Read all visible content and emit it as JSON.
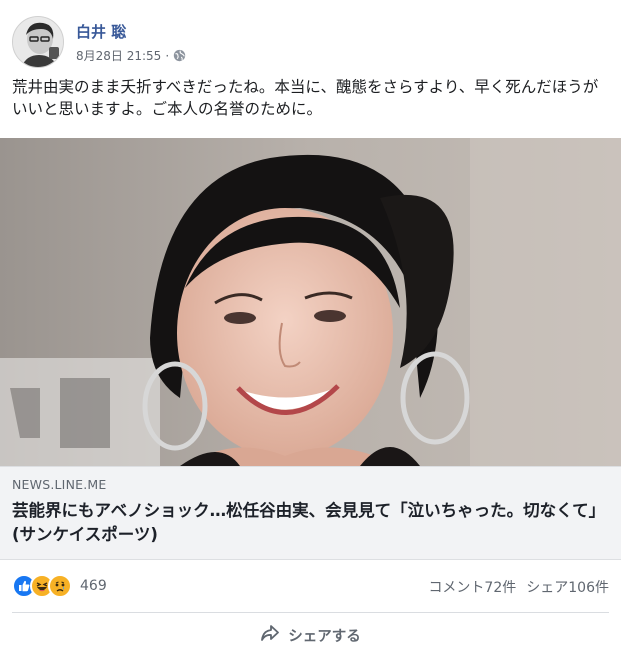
{
  "post": {
    "author": "白井 聡",
    "date": "8月28日 21:55",
    "meta_separator": "·",
    "text": "荒井由実のまま夭折すべきだったね。本当に、醜態をさらすより、早く死んだほうがいいと思いますよ。ご本人の名誉のために。"
  },
  "link_preview": {
    "domain": "NEWS.LINE.ME",
    "title": "芸能界にもアベノショック…松任谷由実、会見見て「泣いちゃった。切なくて」 (サンケイスポーツ)"
  },
  "stats": {
    "reaction_count": "469",
    "reaction_icons": [
      "like-icon",
      "haha-icon",
      "sad-icon"
    ],
    "comments": "コメント72件",
    "shares": "シェア106件"
  },
  "actions": {
    "share_label": "シェアする"
  },
  "colors": {
    "author_link": "#385898",
    "like_blue": "#1877f2",
    "haha_yellow": "#f7b125",
    "meta_gray": "#606770"
  }
}
